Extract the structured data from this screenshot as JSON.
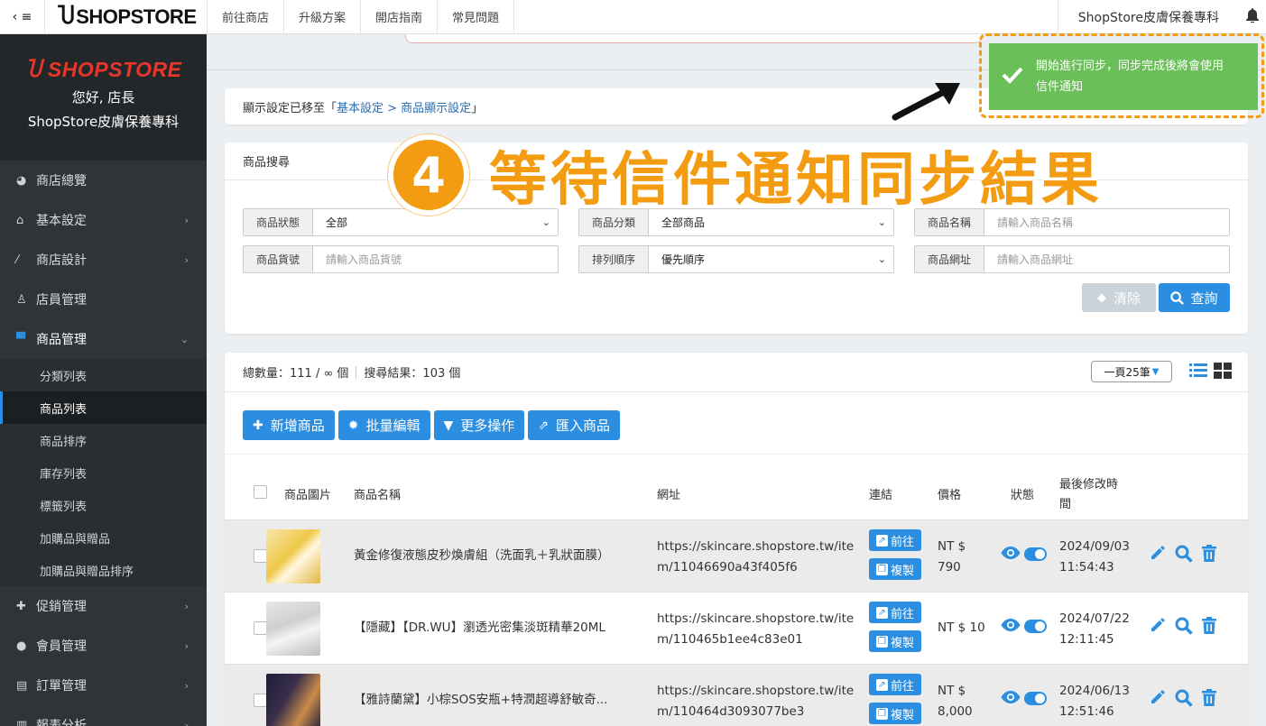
{
  "topbar": {
    "menu_icon": "menu-collapse-icon",
    "logo": "SHOPSTORE",
    "nav": [
      "前往商店",
      "升級方案",
      "開店指南",
      "常見問題"
    ],
    "store_name": "ShopStore皮膚保養專科"
  },
  "sidebar": {
    "logo": "SHOPSTORE",
    "greeting": "您好, 店長",
    "store_name": "ShopStore皮膚保養專科",
    "items": [
      {
        "label": "商店總覽",
        "icon": "dashboard-icon"
      },
      {
        "label": "基本設定",
        "icon": "bank-icon"
      },
      {
        "label": "商店設計",
        "icon": "magic-wand-icon"
      },
      {
        "label": "店員管理",
        "icon": "user-badge-icon"
      },
      {
        "label": "商品管理",
        "icon": "cart-icon"
      },
      {
        "label": "促銷管理",
        "icon": "gift-icon"
      },
      {
        "label": "會員管理",
        "icon": "users-icon"
      },
      {
        "label": "訂單管理",
        "icon": "order-icon"
      },
      {
        "label": "報表分析",
        "icon": "chart-icon"
      }
    ],
    "sub_items": [
      "分類列表",
      "商品列表",
      "商品排序",
      "庫存列表",
      "標籤列表",
      "加購品與贈品",
      "加購品與贈品排序"
    ]
  },
  "notice": {
    "prefix": "顯示設定已移至「",
    "link": "基本設定 > 商品顯示設定",
    "suffix": "」"
  },
  "search": {
    "title": "商品搜尋",
    "fields": [
      {
        "label": "商品狀態",
        "value": "全部"
      },
      {
        "label": "商品分類",
        "value": "全部商品"
      },
      {
        "label": "商品名稱",
        "placeholder": "請輸入商品名稱"
      },
      {
        "label": "商品貨號",
        "placeholder": "請輸入商品貨號"
      },
      {
        "label": "排列順序",
        "value": "優先順序"
      },
      {
        "label": "商品網址",
        "placeholder": "請輸入商品網址"
      }
    ],
    "clear_label": "清除",
    "query_label": "查詢"
  },
  "list": {
    "total": "總數量：111 / ∞ 個",
    "result": "搜尋結果：103 個",
    "per_page": "一頁25筆",
    "actions": [
      {
        "label": "新增商品",
        "icon": "plus-icon"
      },
      {
        "label": "批量編輯",
        "icon": "gear-icon"
      },
      {
        "label": "更多操作",
        "icon": "caret-down-icon"
      },
      {
        "label": "匯入商品",
        "icon": "import-icon"
      }
    ],
    "headers": {
      "image": "商品圖片",
      "name": "商品名稱",
      "url": "網址",
      "link": "連結",
      "price": "價格",
      "status": "狀態",
      "modified_1": "最後修改時",
      "modified_2": "間"
    },
    "link_go": "前往",
    "link_copy": "複製",
    "rows": [
      {
        "name": "黃金修復液態皮秒煥膚組（洗面乳＋乳狀面膜）",
        "url1": "https://skincare.shopstore.tw/ite",
        "url2": "m/11046690a43f405f6",
        "price1": "NT $",
        "price2": "790",
        "date": "2024/09/03",
        "time": "11:54:43"
      },
      {
        "name": "【隱藏】【DR.WU】瀏透光密集淡斑精華20ML",
        "url1": "https://skincare.shopstore.tw/ite",
        "url2": "m/110465b1ee4c83e01",
        "price1": "NT $ 10",
        "price2": "",
        "date": "2024/07/22",
        "time": "12:11:45"
      },
      {
        "name": "【雅詩蘭黛】小棕SOS安瓶+特潤超導舒敏奇...",
        "url1": "https://skincare.shopstore.tw/ite",
        "url2": "m/110464d3093077be3",
        "price1": "NT $",
        "price2": "8,000",
        "date": "2024/06/13",
        "time": "12:51:46"
      }
    ]
  },
  "toast": {
    "line1": "開始進行同步，同步完成後將會使用",
    "line2": "信件通知"
  },
  "annotation": {
    "number": "4",
    "text": "等待信件通知同步結果"
  },
  "colors": {
    "primary": "#2b8ee0",
    "toast": "#6bbf59",
    "annotation": "#f39c12",
    "sidebar": "#2f3438"
  }
}
